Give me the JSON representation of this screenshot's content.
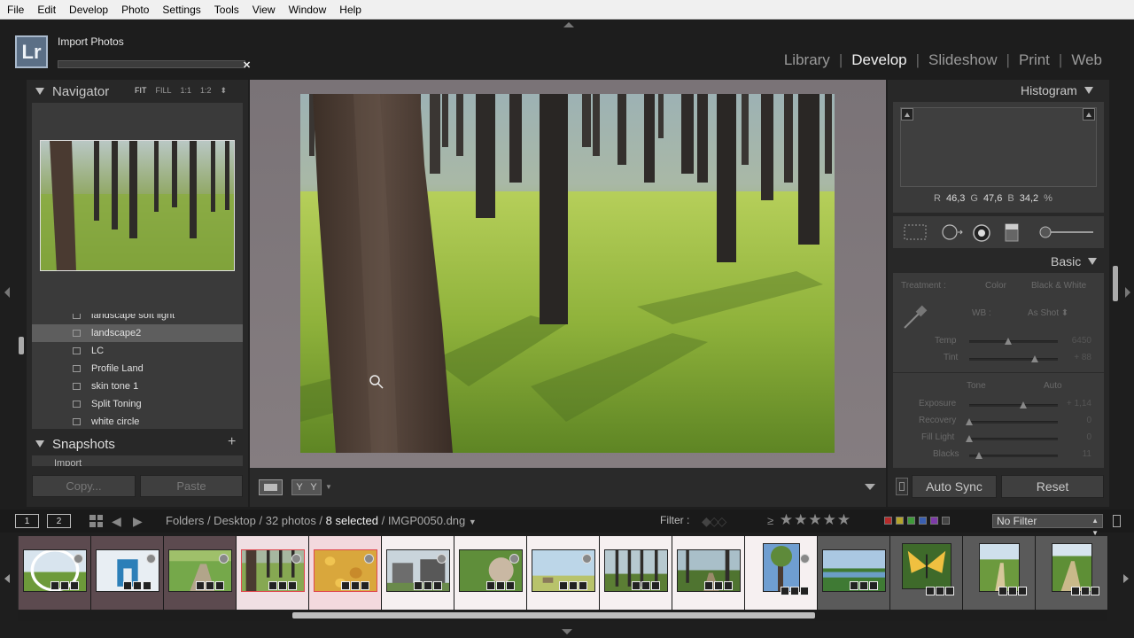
{
  "menu": [
    "File",
    "Edit",
    "Develop",
    "Photo",
    "Settings",
    "Tools",
    "View",
    "Window",
    "Help"
  ],
  "app": {
    "logo": "Lr",
    "activity": "Import Photos",
    "activity_close": "✕"
  },
  "modules": [
    {
      "label": "Library",
      "active": false
    },
    {
      "label": "Develop",
      "active": true
    },
    {
      "label": "Slideshow",
      "active": false
    },
    {
      "label": "Print",
      "active": false
    },
    {
      "label": "Web",
      "active": false
    }
  ],
  "navigator": {
    "title": "Navigator",
    "zoom_options": [
      {
        "label": "FIT",
        "active": true
      },
      {
        "label": "FILL",
        "active": false
      },
      {
        "label": "1:1",
        "active": false
      },
      {
        "label": "1:2",
        "active": false
      }
    ],
    "zoom_caret": "⬍"
  },
  "presets": {
    "items": [
      {
        "label": "landscape soft light",
        "selected": false
      },
      {
        "label": "landscape2",
        "selected": true
      },
      {
        "label": "LC",
        "selected": false
      },
      {
        "label": "Profile Land",
        "selected": false
      },
      {
        "label": "skin tone 1",
        "selected": false
      },
      {
        "label": "Split Toning",
        "selected": false
      },
      {
        "label": "white circle",
        "selected": false
      }
    ]
  },
  "snapshots": {
    "title": "Snapshots",
    "add": "+",
    "first_item": "Import"
  },
  "left_buttons": {
    "copy": "Copy...",
    "paste": "Paste"
  },
  "toolbar": {
    "compare_label": "Y|Y",
    "yy_left": "Y",
    "yy_right": "Y",
    "caret": "▼"
  },
  "histogram": {
    "title": "Histogram",
    "r_label": "R",
    "r": "46,3",
    "g_label": "G",
    "g": "47,6",
    "b_label": "B",
    "b": "34,2",
    "unit": "%"
  },
  "basic": {
    "title": "Basic",
    "treatment_label": "Treatment :",
    "treatment_color": "Color",
    "treatment_bw": "Black & White",
    "wb_label": "WB :",
    "wb_value": "As Shot ⬍",
    "temp_label": "Temp",
    "temp_value": "6450",
    "temp_pos": 0.44,
    "tint_label": "Tint",
    "tint_value": "+ 88",
    "tint_pos": 0.74,
    "tone_label": "Tone",
    "auto_label": "Auto",
    "exposure_label": "Exposure",
    "exposure_value": "+ 1,14",
    "exposure_pos": 0.61,
    "recovery_label": "Recovery",
    "recovery_value": "0",
    "recovery_pos": 0.0,
    "filllight_label": "Fill Light",
    "filllight_value": "0",
    "filllight_pos": 0.0,
    "blacks_label": "Blacks",
    "blacks_value": "11",
    "blacks_pos": 0.11
  },
  "right_buttons": {
    "auto_sync": "Auto Sync",
    "reset": "Reset"
  },
  "filmbar": {
    "view1": "1",
    "view2": "2",
    "breadcrumb_prefix": "Folders / Desktop / 32 photos /",
    "selected": "8 selected",
    "breadcrumb_sep": "/",
    "filename": "IMGP0050.dng",
    "caret": "▼",
    "filter_label": "Filter :",
    "flag_glyphs": "◆◇◇",
    "rating_op": "≥",
    "stars": "★★★★★",
    "no_filter": "No Filter"
  },
  "colors": {
    "accent": "#f2f2f2",
    "panel": "#282828",
    "panel_inner": "#3a3a3a",
    "selected_row": "#5e5e5e"
  },
  "thumbnails": [
    {
      "name": "thumb-1",
      "kind": "pink",
      "scene": "sky-field-round"
    },
    {
      "name": "thumb-2",
      "kind": "pink",
      "scene": "arch-round"
    },
    {
      "name": "thumb-3",
      "kind": "pink",
      "scene": "garden-path"
    },
    {
      "name": "thumb-4",
      "kind": "sel",
      "scene": "forest-active"
    },
    {
      "name": "thumb-5",
      "kind": "sel",
      "scene": "yellow-flowers"
    },
    {
      "name": "thumb-6",
      "kind": "white",
      "scene": "ruins"
    },
    {
      "name": "thumb-7",
      "kind": "white",
      "scene": "hand-plant"
    },
    {
      "name": "thumb-8",
      "kind": "white",
      "scene": "field-sky"
    },
    {
      "name": "thumb-9",
      "kind": "white",
      "scene": "forest-trees"
    },
    {
      "name": "thumb-10",
      "kind": "white",
      "scene": "forest-path"
    },
    {
      "name": "thumb-11",
      "kind": "white",
      "scene": "tree-portrait"
    },
    {
      "name": "thumb-12",
      "kind": "grey",
      "scene": "river-valley"
    },
    {
      "name": "thumb-13",
      "kind": "grey",
      "scene": "butterfly"
    },
    {
      "name": "thumb-14",
      "kind": "grey",
      "scene": "hill-path"
    },
    {
      "name": "thumb-15",
      "kind": "grey",
      "scene": "green-hill"
    }
  ]
}
